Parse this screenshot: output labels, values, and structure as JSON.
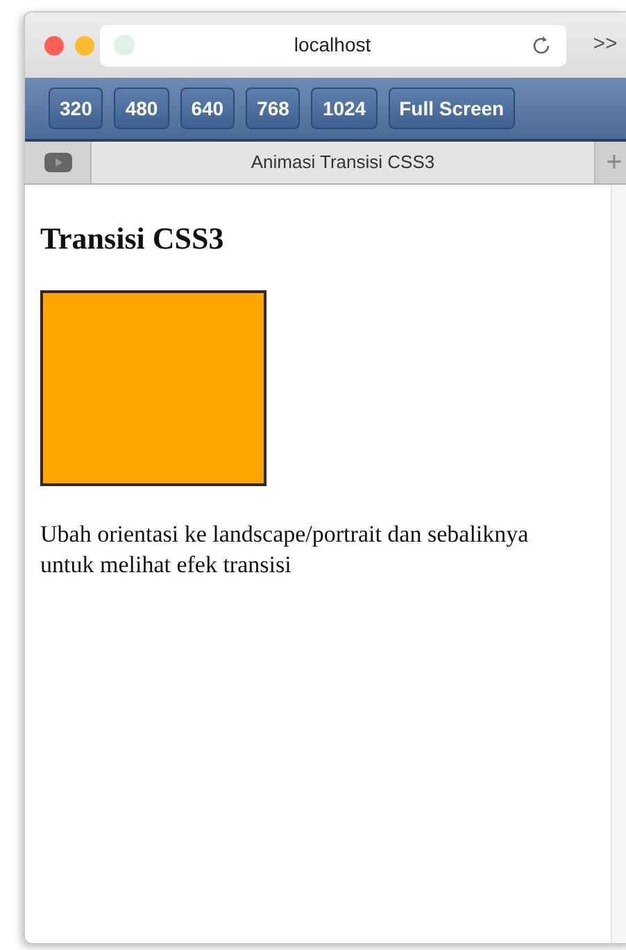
{
  "window": {
    "address": "localhost",
    "overflow": ">>"
  },
  "toolbar": {
    "buttons": [
      "320",
      "480",
      "640",
      "768",
      "1024",
      "Full Screen"
    ]
  },
  "tabs": [
    {
      "label": "Animasi Transisi CSS3"
    }
  ],
  "new_tab": "+",
  "page": {
    "heading": "Transisi CSS3",
    "paragraph": "Ubah orientasi ke landscape/portrait dan sebaliknya untuk melihat efek transisi"
  }
}
